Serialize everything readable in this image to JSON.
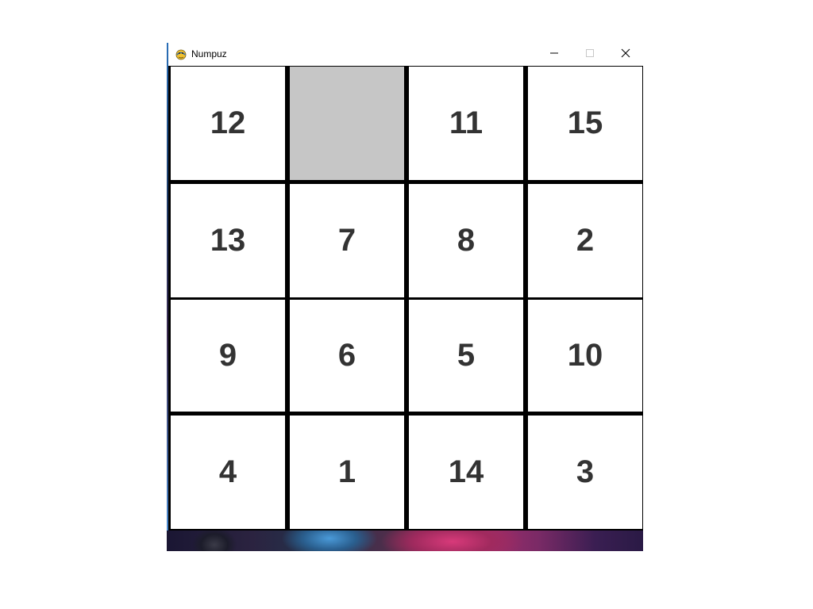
{
  "window": {
    "title": "Numpuz",
    "app_icon": "pygame-snake-icon",
    "controls": {
      "minimize_icon": "minimize-icon",
      "maximize_icon": "maximize-icon",
      "close_icon": "close-icon"
    }
  },
  "board": {
    "rows": 4,
    "cols": 4,
    "tiles": [
      [
        "12",
        "",
        "11",
        "15"
      ],
      [
        "13",
        "7",
        "8",
        "2"
      ],
      [
        "9",
        "6",
        "5",
        "10"
      ],
      [
        "4",
        "1",
        "14",
        "3"
      ]
    ],
    "empty_position": [
      0,
      1
    ]
  },
  "colors": {
    "tile_background": "#ffffff",
    "empty_tile": "#c6c6c6",
    "grid_lines": "#000000",
    "number_text": "#333333"
  }
}
